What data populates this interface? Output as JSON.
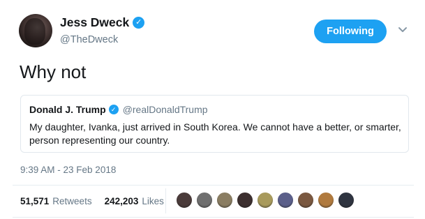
{
  "author": {
    "name": "Jess Dweck",
    "handle": "@TheDweck",
    "verified_icon": "verified-badge-icon",
    "avatar": "profile-photo"
  },
  "follow_button": {
    "label": "Following",
    "color": "#1da1f2"
  },
  "menu_icon": "chevron-down-icon",
  "tweet": {
    "text": "Why not"
  },
  "quoted_tweet": {
    "name": "Donald J. Trump",
    "handle": "@realDonaldTrump",
    "text": "My daughter, Ivanka, just arrived in South Korea. We cannot have a better, or smarter, person representing our country."
  },
  "timestamp": "9:39 AM - 23 Feb 2018",
  "stats": {
    "retweets_count": "51,571",
    "retweets_label": "Retweets",
    "likes_count": "242,203",
    "likes_label": "Likes"
  },
  "likers": [
    {
      "color": "#4a3b3a"
    },
    {
      "color": "#6f6f6f"
    },
    {
      "color": "#8a7d62"
    },
    {
      "color": "#3c2f2f"
    },
    {
      "color": "#a89a5c"
    },
    {
      "color": "#5b5f8a"
    },
    {
      "color": "#7a5840"
    },
    {
      "color": "#b07a3e"
    },
    {
      "color": "#2f3440"
    }
  ]
}
